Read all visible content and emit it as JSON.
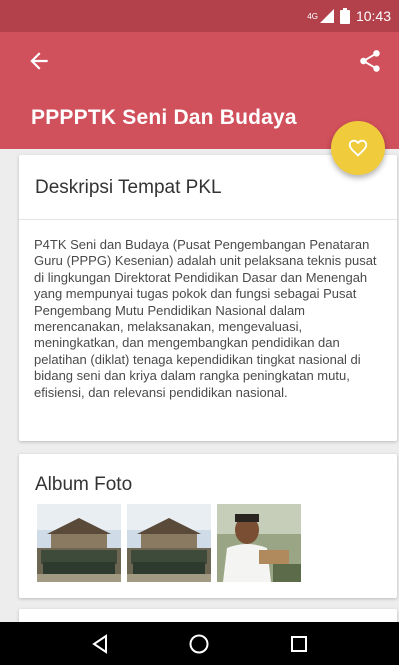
{
  "status_bar": {
    "network": "4G",
    "time": "10:43"
  },
  "app_bar": {
    "title": "PPPPTK Seni Dan Budaya"
  },
  "description_card": {
    "title": "Deskripsi Tempat PKL",
    "body": "P4TK Seni dan Budaya (Pusat Pengembangan Penataran Guru (PPPG) Kesenian) adalah unit pelaksana teknis pusat di lingkungan Direktorat Pendidikan Dasar dan Menengah yang mempunyai tugas pokok dan fungsi sebagai Pusat Pengembang Mutu Pendidikan Nasional dalam merencanakan, melaksanakan, mengevaluasi, meningkatkan, dan mengembangkan pendidikan dan pelatihan (diklat) tenaga kependidikan tingkat nasional di bidang seni dan kriya dalam rangka peningkatan mutu, efisiensi, dan relevansi pendidikan nasional."
  },
  "album_card": {
    "title": "Album Foto",
    "photos": [
      "group-photo-1",
      "group-photo-2",
      "man-crafting-photo"
    ]
  },
  "icons": {
    "back": "arrow-left-icon",
    "share": "share-icon",
    "favorite": "heart-icon"
  },
  "colors": {
    "primary": "#d0505b",
    "primary_dark": "#b3414c",
    "accent": "#f0cc3c"
  }
}
